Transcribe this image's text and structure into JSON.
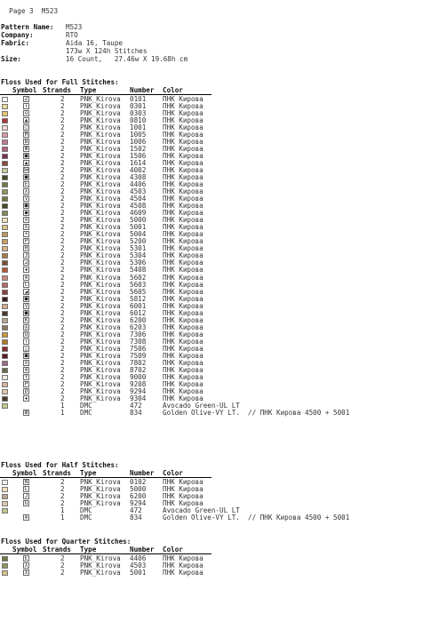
{
  "page": {
    "label": "Page 3",
    "pattern_code": "M523"
  },
  "info": {
    "pattern_name_label": "Pattern Name:",
    "pattern_name": "M523",
    "company_label": "Company:",
    "company": "RTO",
    "fabric_label": "Fabric:",
    "fabric": "Aida 16, Taupe",
    "stitches": "173w X 124h Stitches",
    "size_label": "Size:",
    "size": "16 Count,   27.46w X 19.68h cm"
  },
  "columns": {
    "symbol": "Symbol",
    "strands": "Strands",
    "type": "Type",
    "number": "Number",
    "color": "Color"
  },
  "full": {
    "title": "Floss Used for Full Stitches:",
    "rows": [
      {
        "swatch": "#f4f1f0",
        "sym": "Z",
        "str": "2",
        "type": "PNK_Kirova",
        "num": "0101",
        "color": "ПНК Кирова"
      },
      {
        "swatch": "#e6d896",
        "sym": "↑",
        "str": "2",
        "type": "PNK_Kirova",
        "num": "0301",
        "color": "ПНК Кирова"
      },
      {
        "swatch": "#e4c76f",
        "sym": "o",
        "str": "2",
        "type": "PNK_Kirova",
        "num": "0303",
        "color": "ПНК Кирова"
      },
      {
        "swatch": "#a8363a",
        "sym": "▲",
        "str": "2",
        "type": "PNK_Kirova",
        "num": "0810",
        "color": "ПНК Кирова"
      },
      {
        "swatch": "#f1d6d6",
        "sym": "○",
        "str": "2",
        "type": "PNK_Kirova",
        "num": "1001",
        "color": "ПНК Кирова"
      },
      {
        "swatch": "#d69aa6",
        "sym": "M",
        "str": "2",
        "type": "PNK_Kirova",
        "num": "1005",
        "color": "ПНК Кирова"
      },
      {
        "swatch": "#c27b8f",
        "sym": "B",
        "str": "2",
        "type": "PNK_Kirova",
        "num": "1006",
        "color": "ПНК Кирова"
      },
      {
        "swatch": "#b06080",
        "sym": "Ф",
        "str": "2",
        "type": "PNK_Kirova",
        "num": "1502",
        "color": "ПНК Кирова"
      },
      {
        "swatch": "#7a3050",
        "sym": "■",
        "str": "2",
        "type": "PNK_Kirova",
        "num": "1506",
        "color": "ПНК Кирова"
      },
      {
        "swatch": "#8a4a3a",
        "sym": "▲",
        "str": "2",
        "type": "PNK_Kirova",
        "num": "1614",
        "color": "ПНК Кирова"
      },
      {
        "swatch": "#c4cda0",
        "sym": "⋈",
        "str": "2",
        "type": "PNK_Kirova",
        "num": "4002",
        "color": "ПНК Кирова"
      },
      {
        "swatch": "#3f4a2a",
        "sym": "■",
        "str": "2",
        "type": "PNK_Kirova",
        "num": "4308",
        "color": "ПНК Кирова"
      },
      {
        "swatch": "#6f7a48",
        "sym": "E",
        "str": "2",
        "type": "PNK_Kirova",
        "num": "4406",
        "color": "ПНК Кирова"
      },
      {
        "swatch": "#8d9860",
        "sym": "∧",
        "str": "2",
        "type": "PNK_Kirova",
        "num": "4503",
        "color": "ПНК Кирова"
      },
      {
        "swatch": "#6f7a40",
        "sym": "V",
        "str": "2",
        "type": "PNK_Kirova",
        "num": "4504",
        "color": "ПНК Кирова"
      },
      {
        "swatch": "#3f4a22",
        "sym": "■",
        "str": "2",
        "type": "PNK_Kirova",
        "num": "4508",
        "color": "ПНК Кирова"
      },
      {
        "swatch": "#7e8a55",
        "sym": "●",
        "str": "2",
        "type": "PNK_Kirova",
        "num": "4609",
        "color": "ПНК Кирова"
      },
      {
        "swatch": "#efe2c0",
        "sym": "⊘",
        "str": "2",
        "type": "PNK_Kirova",
        "num": "5000",
        "color": "ПНК Кирова"
      },
      {
        "swatch": "#d8c08a",
        "sym": "X",
        "str": "2",
        "type": "PNK_Kirova",
        "num": "5001",
        "color": "ПНК Кирова"
      },
      {
        "swatch": "#b89a60",
        "sym": "+",
        "str": "2",
        "type": "PNK_Kirova",
        "num": "5004",
        "color": "ПНК Кирова"
      },
      {
        "swatch": "#c8a060",
        "sym": "P",
        "str": "2",
        "type": "PNK_Kirova",
        "num": "5200",
        "color": "ПНК Кирова"
      },
      {
        "swatch": "#d6b484",
        "sym": "H",
        "str": "2",
        "type": "PNK_Kirova",
        "num": "5301",
        "color": "ПНК Кирова"
      },
      {
        "swatch": "#a87a4a",
        "sym": "3",
        "str": "2",
        "type": "PNK_Kirova",
        "num": "5304",
        "color": "ПНК Кирова"
      },
      {
        "swatch": "#7a5030",
        "sym": "⊿",
        "str": "2",
        "type": "PNK_Kirova",
        "num": "5306",
        "color": "ПНК Кирова"
      },
      {
        "swatch": "#b05a30",
        "sym": "✚",
        "str": "2",
        "type": "PNK_Kirova",
        "num": "5408",
        "color": "ПНК Кирова"
      },
      {
        "swatch": "#c88a80",
        "sym": "⊗",
        "str": "2",
        "type": "PNK_Kirova",
        "num": "5602",
        "color": "ПНК Кирова"
      },
      {
        "swatch": "#b06a6a",
        "sym": "C",
        "str": "2",
        "type": "PNK_Kirova",
        "num": "5603",
        "color": "ПНК Кирова"
      },
      {
        "swatch": "#8a4040",
        "sym": "◢",
        "str": "2",
        "type": "PNK_Kirova",
        "num": "5605",
        "color": "ПНК Кирова"
      },
      {
        "swatch": "#3a2020",
        "sym": "■",
        "str": "2",
        "type": "PNK_Kirova",
        "num": "5812",
        "color": "ПНК Кирова"
      },
      {
        "swatch": "#d6a890",
        "sym": "V",
        "str": "2",
        "type": "PNK_Kirova",
        "num": "6001",
        "color": "ПНК Кирова"
      },
      {
        "swatch": "#4a3a30",
        "sym": "■",
        "str": "2",
        "type": "PNK_Kirova",
        "num": "6012",
        "color": "ПНК Кирова"
      },
      {
        "swatch": "#b8a890",
        "sym": "K",
        "str": "2",
        "type": "PNK_Kirova",
        "num": "6200",
        "color": "ПНК Кирова"
      },
      {
        "swatch": "#8a7a62",
        "sym": "◎",
        "str": "2",
        "type": "PNK_Kirova",
        "num": "6203",
        "color": "ПНК Кирова"
      },
      {
        "swatch": "#c89a40",
        "sym": "O",
        "str": "2",
        "type": "PNK_Kirova",
        "num": "7306",
        "color": "ПНК Кирова"
      },
      {
        "swatch": "#b07a28",
        "sym": "↑",
        "str": "2",
        "type": "PNK_Kirova",
        "num": "7308",
        "color": "ПНК Кирова"
      },
      {
        "swatch": "#8a2a2a",
        "sym": "△",
        "str": "2",
        "type": "PNK_Kirova",
        "num": "7506",
        "color": "ПНК Кирова"
      },
      {
        "swatch": "#5a1a20",
        "sym": "■",
        "str": "2",
        "type": "PNK_Kirova",
        "num": "7509",
        "color": "ПНК Кирова"
      },
      {
        "swatch": "#9a6a8a",
        "sym": "⊘",
        "str": "2",
        "type": "PNK_Kirova",
        "num": "7802",
        "color": "ПНК Кирова"
      },
      {
        "swatch": "#6a6a4a",
        "sym": "⊗",
        "str": "2",
        "type": "PNK_Kirova",
        "num": "8702",
        "color": "ПНК Кирова"
      },
      {
        "swatch": "#ece8e0",
        "sym": "Y",
        "str": "2",
        "type": "PNK_Kirova",
        "num": "9000",
        "color": "ПНК Кирова"
      },
      {
        "swatch": "#d8b4a0",
        "sym": "P",
        "str": "2",
        "type": "PNK_Kirova",
        "num": "9208",
        "color": "ПНК Кирова"
      },
      {
        "swatch": "#e2c8b0",
        "sym": "D",
        "str": "2",
        "type": "PNK_Kirova",
        "num": "9294",
        "color": "ПНК Кирова"
      },
      {
        "swatch": "#4a3a32",
        "sym": "✚",
        "str": "2",
        "type": "PNK_Kirova",
        "num": "9304",
        "color": "ПНК Кирова"
      },
      {
        "swatch": "#c0c890",
        "sym": "",
        "str": "1",
        "type": "DMC",
        "num": "472",
        "color": "Avocado Green-UL LT"
      },
      {
        "swatch": "",
        "sym": "⊠",
        "str": "1",
        "type": "DMC",
        "num": "834",
        "color": "Golden Olive-VY LT.  // ПНК Кирова 4500 + 5001"
      }
    ]
  },
  "half": {
    "title": "Floss Used for Half Stitches:",
    "rows": [
      {
        "swatch": "#f4f1f0",
        "sym": "N",
        "str": "2",
        "type": "PNK_Kirova",
        "num": "0102",
        "color": "ПНК Кирова"
      },
      {
        "swatch": "#efe2c0",
        "sym": "L",
        "str": "2",
        "type": "PNK_Kirova",
        "num": "5000",
        "color": "ПНК Кирова"
      },
      {
        "swatch": "#b8a890",
        "sym": "J",
        "str": "2",
        "type": "PNK_Kirova",
        "num": "6200",
        "color": "ПНК Кирова"
      },
      {
        "swatch": "#e2c8b0",
        "sym": "G",
        "str": "2",
        "type": "PNK_Kirova",
        "num": "9294",
        "color": "ПНК Кирова"
      },
      {
        "swatch": "#c0c890",
        "sym": "",
        "str": "1",
        "type": "DMC",
        "num": "472",
        "color": "Avocado Green-UL LT"
      },
      {
        "swatch": "",
        "sym": "⊗",
        "str": "1",
        "type": "DMC",
        "num": "834",
        "color": "Golden Olive-VY LT.  // ПНК Кирова 4500 + 5001"
      }
    ]
  },
  "quarter": {
    "title": "Floss Used for Quarter Stitches:",
    "rows": [
      {
        "swatch": "#6f7a48",
        "sym": "E",
        "str": "2",
        "type": "PNK_Kirova",
        "num": "4406",
        "color": "ПНК Кирова"
      },
      {
        "swatch": "#8d9860",
        "sym": "∧",
        "str": "2",
        "type": "PNK_Kirova",
        "num": "4503",
        "color": "ПНК Кирова"
      },
      {
        "swatch": "#d8c08a",
        "sym": "X",
        "str": "2",
        "type": "PNK_Kirova",
        "num": "5001",
        "color": "ПНК Кирова"
      }
    ]
  }
}
